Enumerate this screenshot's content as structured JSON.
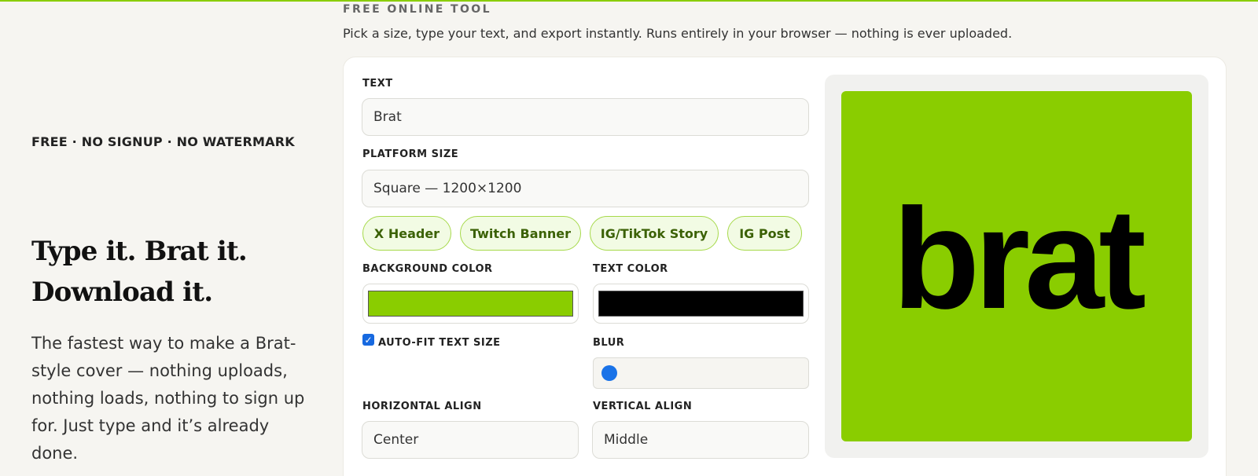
{
  "colors": {
    "accent": "#8acd00",
    "background_color": "#8acd00",
    "text_color": "#000000"
  },
  "hero": {
    "eyebrow": "FREE · NO SIGNUP · NO WATERMARK",
    "headline": "Type it. Brat it. Download it.",
    "lede": "The fastest way to make a Brat-style cover — nothing uploads, nothing loads, nothing to sign up for. Just type and it’s already done."
  },
  "tool": {
    "eyebrow": "FREE ONLINE TOOL",
    "subtitle": "Pick a size, type your text, and export instantly. Runs entirely in your browser — nothing is ever uploaded."
  },
  "form": {
    "text_label": "TEXT",
    "text_value": "Brat",
    "platform_label": "PLATFORM SIZE",
    "platform_value": "Square — 1200×1200",
    "presets": [
      "X Header",
      "Twitch Banner",
      "IG/TikTok Story",
      "IG Post"
    ],
    "bg_color_label": "BACKGROUND COLOR",
    "text_color_label": "TEXT COLOR",
    "autofit_label": "AUTO-FIT TEXT SIZE",
    "autofit_checked": true,
    "blur_label": "BLUR",
    "blur_value": 0,
    "halign_label": "HORIZONTAL ALIGN",
    "halign_value": "Center",
    "valign_label": "VERTICAL ALIGN",
    "valign_value": "Middle"
  },
  "preview": {
    "text": "brat"
  }
}
